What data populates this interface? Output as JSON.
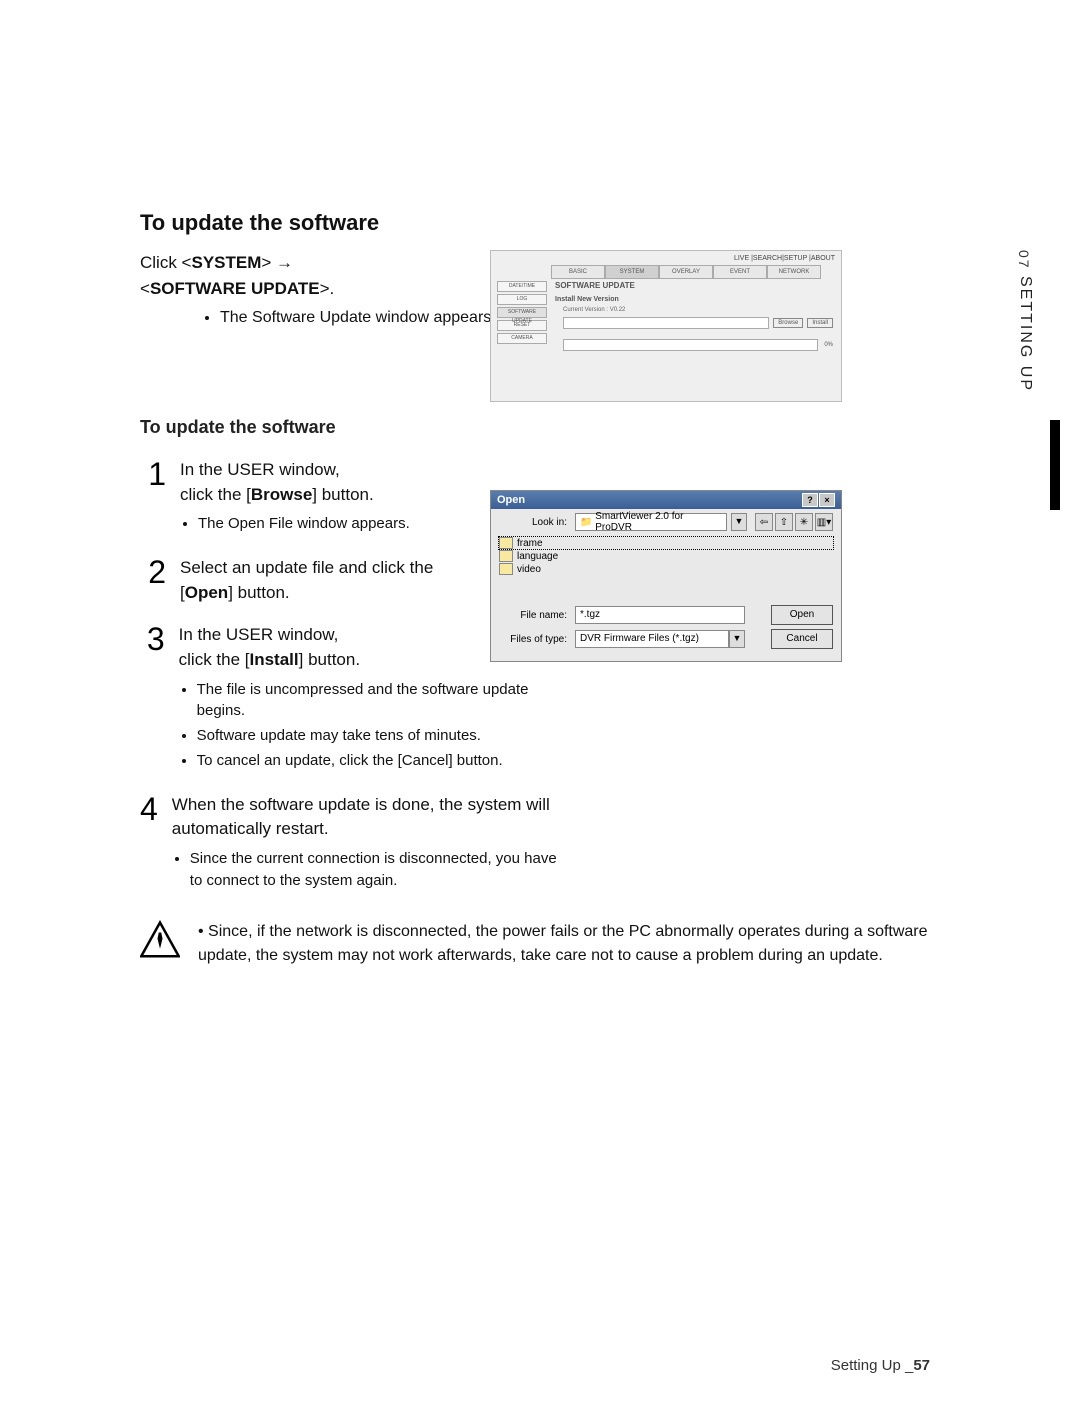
{
  "side_tab": {
    "chapter_num": "07",
    "chapter_label": "SETTING UP"
  },
  "title": "To update the software",
  "intro": {
    "prefix": "Click <",
    "system": "SYSTEM",
    "arrow": "> →",
    "line2_open": "<",
    "swupdate": "SOFTWARE UPDATE",
    "line2_close": ">.",
    "bullet": "The Software Update window appears."
  },
  "screenshot1": {
    "topnav": "LIVE  |SEARCH|SETUP |ABOUT",
    "tabs": [
      "BASIC",
      "SYSTEM",
      "OVERLAY",
      "EVENT",
      "NETWORK"
    ],
    "side": [
      "DATE/TIME",
      "LOG",
      "SOFTWARE UPDATE",
      "RESET",
      "CAMERA"
    ],
    "heading": "SOFTWARE UPDATE",
    "sub": "Install New Version",
    "version": "Current Version : V0.22",
    "browse": "Browse",
    "install": "Install",
    "progress": "0%"
  },
  "sub_title": "To update the software",
  "steps": [
    {
      "num": "1",
      "line1": "In the USER window,",
      "line2a": "click the [",
      "line2b": "Browse",
      "line2c": "] button.",
      "bullets": [
        "The Open File window appears."
      ]
    },
    {
      "num": "2",
      "line1": "Select an update file and click the",
      "line2a": "[",
      "line2b": "Open",
      "line2c": "] button.",
      "bullets": []
    },
    {
      "num": "3",
      "line1": "In the USER window,",
      "line2a": "click the [",
      "line2b": "Install",
      "line2c": "] button.",
      "bullets": [
        "The file is uncompressed and the software update begins.",
        "Software update may take tens of minutes.",
        "To cancel an update, click the [Cancel] button."
      ]
    },
    {
      "num": "4",
      "line1": "When the software update is done, the system will automatically restart.",
      "bullets": [
        "Since the current connection is disconnected, you have to connect to the system again."
      ]
    }
  ],
  "warning": "Since, if the network is disconnected, the power fails or the PC abnormally operates during a software update, the system may not work afterwards, take care not to cause a problem during an update.",
  "screenshot2": {
    "title": "Open",
    "lookin_label": "Look in:",
    "lookin_value": "SmartViewer 2.0 for ProDVR",
    "folders": [
      "frame",
      "language",
      "video"
    ],
    "filename_label": "File name:",
    "filename_value": "*.tgz",
    "filetype_label": "Files of type:",
    "filetype_value": "DVR Firmware Files (*.tgz)",
    "open_btn": "Open",
    "cancel_btn": "Cancel"
  },
  "footer": {
    "section": "Setting Up _",
    "page": "57"
  }
}
